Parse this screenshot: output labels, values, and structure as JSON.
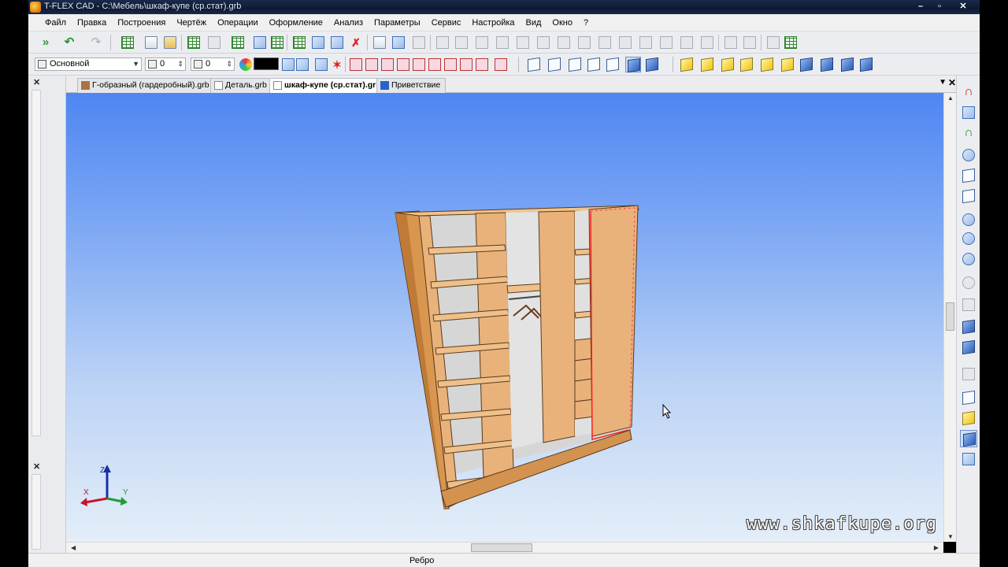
{
  "window": {
    "title": "T-FLEX CAD - C:\\Мебель\\шкаф-купе (ср.стат).grb"
  },
  "menu": [
    "Файл",
    "Правка",
    "Построения",
    "Чертёж",
    "Операции",
    "Оформление",
    "Анализ",
    "Параметры",
    "Сервис",
    "Настройка",
    "Вид",
    "Окно",
    "?"
  ],
  "toolbar2": {
    "layer_value": "Основной",
    "level_value": "0",
    "priority_value": "0",
    "color": "#000000"
  },
  "tabs": [
    {
      "label": "Г-образный (гардеробный).grb",
      "active": false
    },
    {
      "label": "Деталь.grb",
      "active": false
    },
    {
      "label": "шкаф-купе (ср.стат).grb",
      "active": true
    },
    {
      "label": "Приветствие",
      "active": false
    }
  ],
  "viewport": {
    "watermark": "www.shkafkupe.org",
    "axes": {
      "x": "X",
      "y": "Y",
      "z": "Z"
    }
  },
  "status": {
    "text": "Ребро"
  },
  "colors": {
    "viewport_top": "#4e86f2",
    "viewport_bottom": "#e4eef8",
    "wood": "#e9b27a",
    "selection": "#ff2020"
  }
}
